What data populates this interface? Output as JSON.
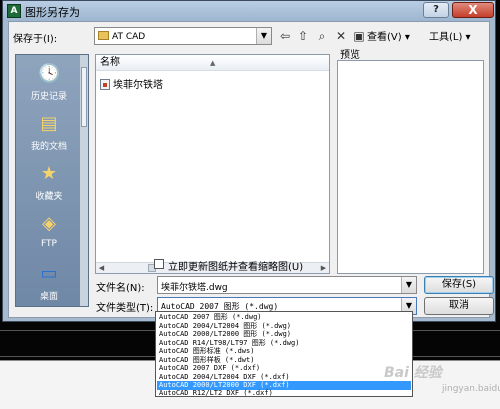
{
  "window": {
    "title": "图形另存为",
    "help_label": "?",
    "close_label": "X"
  },
  "toolbar": {
    "savein_label": "保存于(I):",
    "savein_value": "AT CAD",
    "views_label": "查看(V)",
    "tools_label": "工具(L)",
    "icons": [
      "back-icon",
      "up-folder-icon",
      "search-web-icon",
      "delete-icon",
      "new-folder-icon",
      "views-icon"
    ]
  },
  "places": [
    {
      "label": "历史记录",
      "icon": "history-icon"
    },
    {
      "label": "我的文档",
      "icon": "documents-icon"
    },
    {
      "label": "收藏夹",
      "icon": "favorites-icon"
    },
    {
      "label": "FTP",
      "icon": "ftp-icon"
    },
    {
      "label": "桌面",
      "icon": "desktop-icon"
    }
  ],
  "file_list": {
    "column_name": "名称",
    "files": [
      {
        "name": "埃菲尔铁塔",
        "icon": "dwg-file-icon"
      }
    ]
  },
  "preview": {
    "label": "预览"
  },
  "options": {
    "update_thumbnail_label": "立即更新图纸并查看缩略图(U)",
    "update_thumbnail_checked": false
  },
  "form": {
    "filename_label": "文件名(N):",
    "filename_value": "埃菲尔铁塔.dwg",
    "filetype_label": "文件类型(T):",
    "filetype_value": "AutoCAD 2007 图形 (*.dwg)",
    "save_label": "保存(S)",
    "cancel_label": "取消"
  },
  "filetype_options": [
    "AutoCAD 2007 图形 (*.dwg)",
    "AutoCAD 2004/LT2004 图形 (*.dwg)",
    "AutoCAD 2000/LT2000 图形 (*.dwg)",
    "AutoCAD R14/LT98/LT97 图形 (*.dwg)",
    "AutoCAD 图形标准 (*.dws)",
    "AutoCAD 图形样板 (*.dwt)",
    "AutoCAD 2007 DXF (*.dxf)",
    "AutoCAD 2004/LT2004 DXF (*.dxf)",
    "AutoCAD 2000/LT2000 DXF (*.dxf)",
    "AutoCAD R12/LT2 DXF (*.dxf)"
  ],
  "filetype_selected_index": 8,
  "watermark": {
    "text": "Bai 经验",
    "sub": "jingyan.baidu.com"
  }
}
